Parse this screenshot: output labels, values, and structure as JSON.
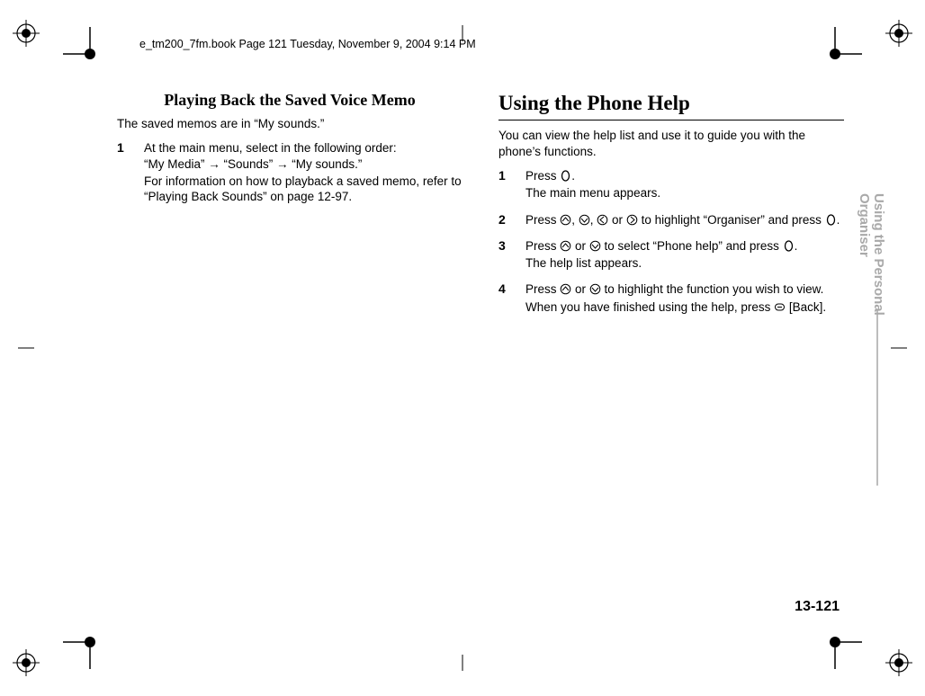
{
  "running_header": "e_tm200_7fm.book  Page 121  Tuesday, November 9, 2004  9:14 PM",
  "left": {
    "heading": "Playing Back the Saved Voice Memo",
    "intro": "The saved memos are in “My sounds.”",
    "steps": [
      {
        "num": "1",
        "line1a": "At the main menu, select in the following order:",
        "line1b_pre": "“My Media” ",
        "line1b_mid1": " “Sounds” ",
        "line1b_mid2": " “My sounds.”",
        "line2": "For information on how to playback a saved memo, refer to “Playing Back Sounds” on page 12-97."
      }
    ]
  },
  "right": {
    "heading": "Using the Phone Help",
    "intro": "You can view the help list and use it to guide you with the phone’s functions.",
    "steps": [
      {
        "num": "1",
        "line1_pre": "Press ",
        "line1_post": ".",
        "line2": "The main menu appears."
      },
      {
        "num": "2",
        "line1_pre": "Press ",
        "line1_sep": ", ",
        "line1_or": " or ",
        "line1_mid": " to highlight “Organiser” and press ",
        "line1_post": "."
      },
      {
        "num": "3",
        "line1_pre": "Press ",
        "line1_or": " or ",
        "line1_mid": " to select “Phone help” and press ",
        "line1_post": ".",
        "line2": "The help list appears."
      },
      {
        "num": "4",
        "line1_pre": "Press ",
        "line1_or": " or ",
        "line1_mid": " to highlight the function you wish to view.",
        "line2_pre": "When you have finished using the help, press ",
        "line2_post": " [Back]."
      }
    ]
  },
  "side_tab": "Using the Personal \nOrganiser",
  "page_number": "13-121"
}
